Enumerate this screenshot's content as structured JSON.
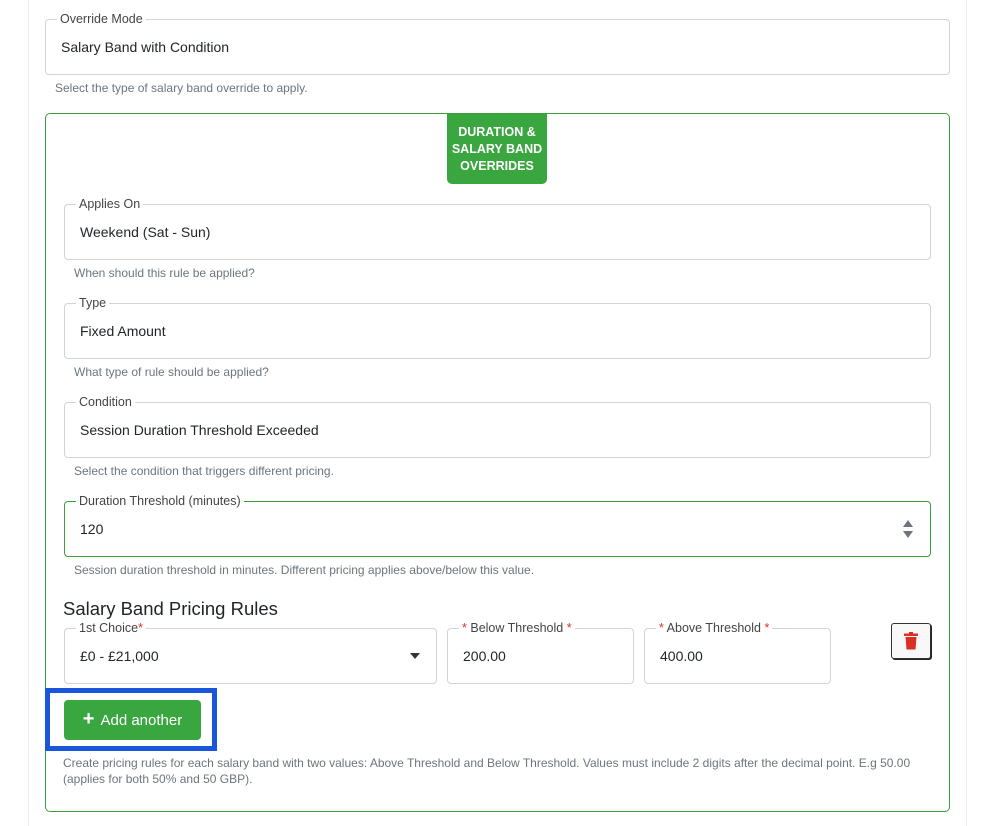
{
  "override_mode": {
    "label": "Override Mode",
    "value": "Salary Band with Condition",
    "helper": "Select the type of salary band override to apply."
  },
  "section": {
    "badge": "DURATION & SALARY BAND OVERRIDES",
    "accent_color": "#3aa640",
    "applies_on": {
      "label": "Applies On",
      "value": "Weekend (Sat - Sun)",
      "helper": "When should this rule be applied?"
    },
    "type": {
      "label": "Type",
      "value": "Fixed Amount",
      "helper": "What type of rule should be applied?"
    },
    "condition": {
      "label": "Condition",
      "value": "Session Duration Threshold Exceeded",
      "helper": "Select the condition that triggers different pricing."
    },
    "duration_threshold": {
      "label": "Duration Threshold (minutes)",
      "value": "120",
      "helper": "Session duration threshold in minutes. Different pricing applies above/below this value."
    },
    "rules": {
      "heading": "Salary Band Pricing Rules",
      "choice": {
        "label": "1st Choice",
        "required_mark": "*",
        "value": "£0 - £21,000"
      },
      "below": {
        "label": "Below Threshold",
        "required_mark": "*",
        "value": "200.00"
      },
      "above": {
        "label": "Above Threshold",
        "required_mark": "*",
        "value": "400.00"
      },
      "delete_icon": "trash-icon",
      "add_label": "Add another",
      "add_icon": "plus-icon",
      "help": "Create pricing rules for each salary band with two values: Above Threshold and Below Threshold. Values must include 2 digits after the decimal point. E.g 50.00 (applies for both 50% and 50 GBP)."
    }
  },
  "colors": {
    "highlight": "#1a56db",
    "delete": "#d93025"
  }
}
